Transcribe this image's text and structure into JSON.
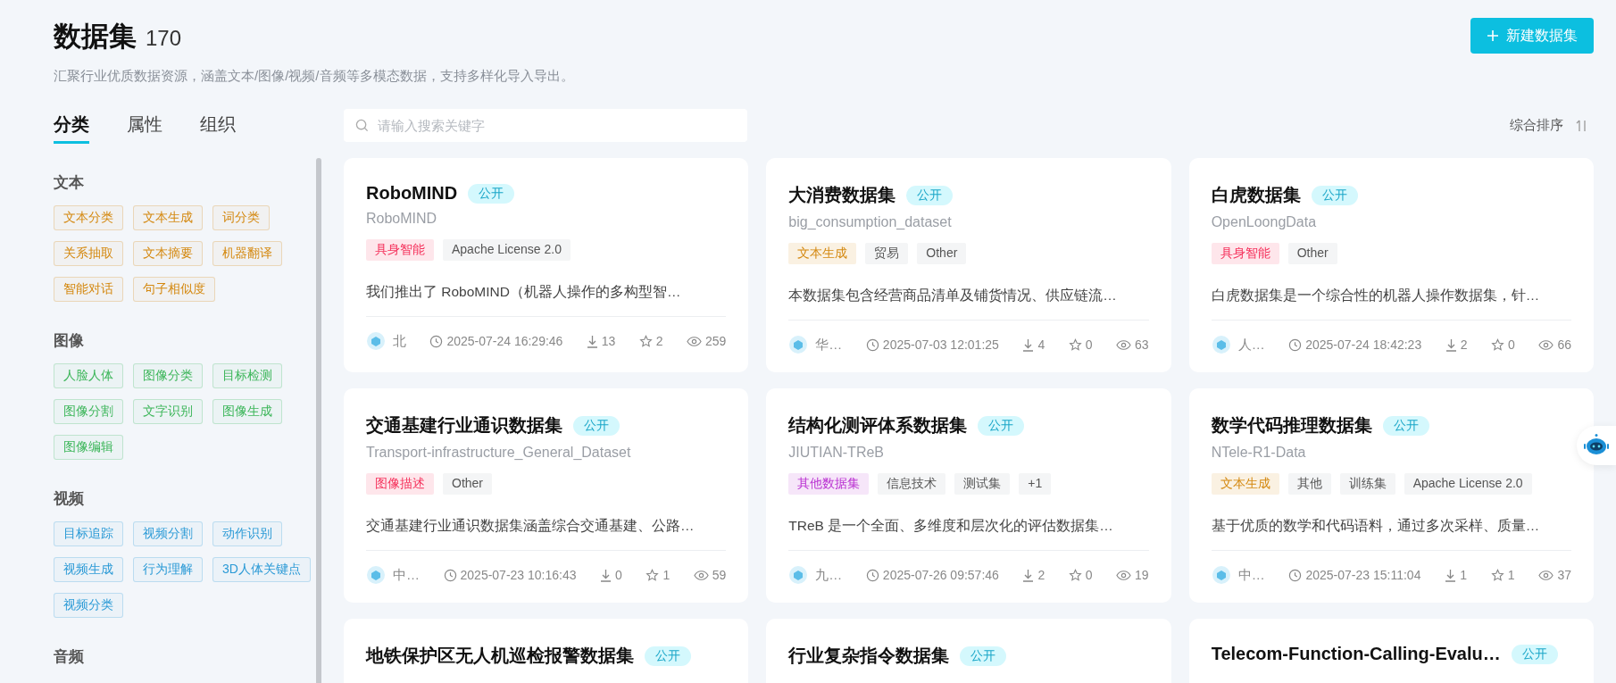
{
  "header": {
    "title": "数据集",
    "count": "170",
    "subtitle": "汇聚行业优质数据资源，涵盖文本/图像/视频/音频等多模态数据，支持多样化导入导出。",
    "new_button": "新建数据集"
  },
  "sidebar": {
    "tabs": [
      {
        "label": "分类",
        "selected": true
      },
      {
        "label": "属性",
        "selected": false
      },
      {
        "label": "组织",
        "selected": false
      }
    ],
    "sections": [
      {
        "title": "文本",
        "color": "#d4880f",
        "tags": [
          "文本分类",
          "文本生成",
          "词分类",
          "关系抽取",
          "文本摘要",
          "机器翻译",
          "智能对话",
          "句子相似度"
        ]
      },
      {
        "title": "图像",
        "color": "#3db65a",
        "tags": [
          "人脸人体",
          "图像分类",
          "目标检测",
          "图像分割",
          "文字识别",
          "图像生成",
          "图像编辑"
        ]
      },
      {
        "title": "视频",
        "color": "#2b9ad6",
        "tags": [
          "目标追踪",
          "视频分割",
          "动作识别",
          "视频生成",
          "行为理解",
          "3D人体关键点",
          "视频分类"
        ]
      },
      {
        "title": "音频"
      }
    ]
  },
  "search": {
    "placeholder": "请输入搜索关键字"
  },
  "sort": {
    "label": "综合排序"
  },
  "cards": [
    {
      "title": "RoboMIND",
      "badge": "公开",
      "subtitle": "RoboMIND",
      "tags": [
        {
          "label": "具身智能",
          "color": "#f5325c"
        },
        {
          "label": "Apache License 2.0"
        }
      ],
      "description": "我们推出了 RoboMIND（机器人操作的多构型智…",
      "org": "北",
      "time": "2025-07-24 16:29:46",
      "downloads": "13",
      "stars": "2",
      "views": "259"
    },
    {
      "title": "大消费数据集",
      "badge": "公开",
      "subtitle": "big_consumption_dataset",
      "tags": [
        {
          "label": "文本生成",
          "color": "#d4880f"
        },
        {
          "label": "贸易"
        },
        {
          "label": "Other"
        }
      ],
      "description": "本数据集包含经营商品清单及铺货情况、供应链流…",
      "org": "华…",
      "time": "2025-07-03 12:01:25",
      "downloads": "4",
      "stars": "0",
      "views": "63"
    },
    {
      "title": "白虎数据集",
      "badge": "公开",
      "subtitle": "OpenLoongData",
      "tags": [
        {
          "label": "具身智能",
          "color": "#f5325c"
        },
        {
          "label": "Other"
        }
      ],
      "description": "白虎数据集是一个综合性的机器人操作数据集，针…",
      "org": "人…",
      "time": "2025-07-24 18:42:23",
      "downloads": "2",
      "stars": "0",
      "views": "66"
    },
    {
      "title": "交通基建行业通识数据集",
      "badge": "公开",
      "subtitle": "Transport-infrastructure_General_Dataset",
      "tags": [
        {
          "label": "图像描述",
          "color": "#f5325c"
        },
        {
          "label": "Other"
        }
      ],
      "description": "交通基建行业通识数据集涵盖综合交通基建、公路…",
      "org": "中…",
      "time": "2025-07-23 10:16:43",
      "downloads": "0",
      "stars": "1",
      "views": "59"
    },
    {
      "title": "结构化测评体系数据集",
      "badge": "公开",
      "subtitle": "JIUTIAN-TReB",
      "tags": [
        {
          "label": "其他数据集",
          "color": "#b92fd1"
        },
        {
          "label": "信息技术"
        },
        {
          "label": "测试集"
        },
        {
          "label": "+1"
        }
      ],
      "description": "TReB 是一个全面、多维度和层次化的评估数据集…",
      "org": "九…",
      "time": "2025-07-26 09:57:46",
      "downloads": "2",
      "stars": "0",
      "views": "19"
    },
    {
      "title": "数学代码推理数据集",
      "badge": "公开",
      "subtitle": "NTele-R1-Data",
      "tags": [
        {
          "label": "文本生成",
          "color": "#d4880f"
        },
        {
          "label": "其他"
        },
        {
          "label": "训练集"
        },
        {
          "label": "Apache License 2.0"
        }
      ],
      "description": "基于优质的数学和代码语料，通过多次采样、质量…",
      "org": "中…",
      "time": "2025-07-23 15:11:04",
      "downloads": "1",
      "stars": "1",
      "views": "37"
    },
    {
      "title": "地铁保护区无人机巡检报警数据集",
      "badge": "公开"
    },
    {
      "title": "行业复杂指令数据集",
      "badge": "公开"
    },
    {
      "title": "Telecom-Function-Calling-Evalu…",
      "badge": "公开"
    }
  ]
}
